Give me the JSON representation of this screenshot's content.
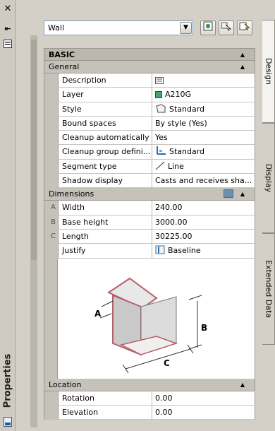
{
  "palette": {
    "title": "Properties"
  },
  "toolbar": {
    "object_type": "Wall",
    "quick_select_label": "Quick Select",
    "select_objects_label": "Select Objects",
    "toggle_pickadd_label": "Toggle PICKADD"
  },
  "tabs": [
    "Design",
    "Display",
    "Extended Data"
  ],
  "basic": {
    "title": "BASIC",
    "general": {
      "title": "General",
      "rows": [
        {
          "name": "Description",
          "value": ""
        },
        {
          "name": "Layer",
          "value": "A210G"
        },
        {
          "name": "Style",
          "value": "Standard"
        },
        {
          "name": "Bound spaces",
          "value": "By style (Yes)"
        },
        {
          "name": "Cleanup automatically",
          "value": "Yes"
        },
        {
          "name": "Cleanup group defini...",
          "value": "Standard"
        },
        {
          "name": "Segment type",
          "value": "Line"
        },
        {
          "name": "Shadow display",
          "value": "Casts and receives sha..."
        }
      ]
    },
    "dimensions": {
      "title": "Dimensions",
      "rows": [
        {
          "key": "A",
          "name": "Width",
          "value": "240.00"
        },
        {
          "key": "B",
          "name": "Base height",
          "value": "3000.00"
        },
        {
          "key": "C",
          "name": "Length",
          "value": "30225.00"
        },
        {
          "key": "",
          "name": "Justify",
          "value": "Baseline"
        }
      ],
      "diagram_labels": {
        "a": "A",
        "b": "B",
        "c": "C"
      }
    },
    "location": {
      "title": "Location",
      "rows": [
        {
          "name": "Rotation",
          "value": "0.00"
        },
        {
          "name": "Elevation",
          "value": "0.00"
        }
      ]
    }
  },
  "colors": {
    "layer_swatch": "#3aa86a",
    "wall_face": "#d8d8d8",
    "wall_edge": "#b5606a"
  }
}
